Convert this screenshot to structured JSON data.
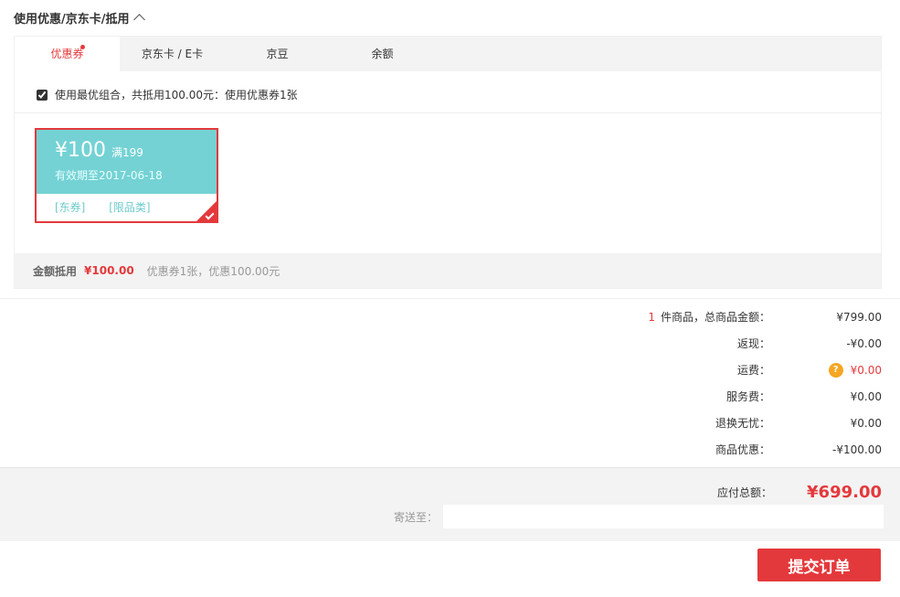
{
  "section": {
    "title": "使用优惠/京东卡/抵用"
  },
  "tabs": [
    {
      "label": "优惠券"
    },
    {
      "label": "京东卡 / E卡"
    },
    {
      "label": "京豆"
    },
    {
      "label": "余额"
    }
  ],
  "combo": {
    "label": "使用最优组合，共抵用100.00元：使用优惠券1张",
    "checked": true
  },
  "coupon": {
    "amount": "¥100",
    "condition": "满199",
    "expiry": "有效期至2017-06-18",
    "tags": [
      "[东券]",
      "[限品类]"
    ]
  },
  "discount_summary": {
    "label": "金额抵用",
    "amount": "¥100.00",
    "desc": "优惠券1张，优惠100.00元"
  },
  "order_summary": {
    "count": "1",
    "rows": [
      {
        "label": "件商品，总商品金额：",
        "value": "¥799.00"
      },
      {
        "label": "返现：",
        "value": "-¥0.00"
      },
      {
        "label": "运费：",
        "value": "¥0.00"
      },
      {
        "label": "服务费：",
        "value": "¥0.00"
      },
      {
        "label": "退换无忧：",
        "value": "¥0.00"
      },
      {
        "label": "商品优惠：",
        "value": "-¥100.00"
      }
    ]
  },
  "total": {
    "label": "应付总额：",
    "value": "¥699.00"
  },
  "address": {
    "label": "寄送至：",
    "value": ""
  },
  "submit": {
    "label": "提交订单"
  },
  "colors": {
    "accent": "#e4393c",
    "coupon": "#74d2d4",
    "warning": "#f5a623"
  }
}
